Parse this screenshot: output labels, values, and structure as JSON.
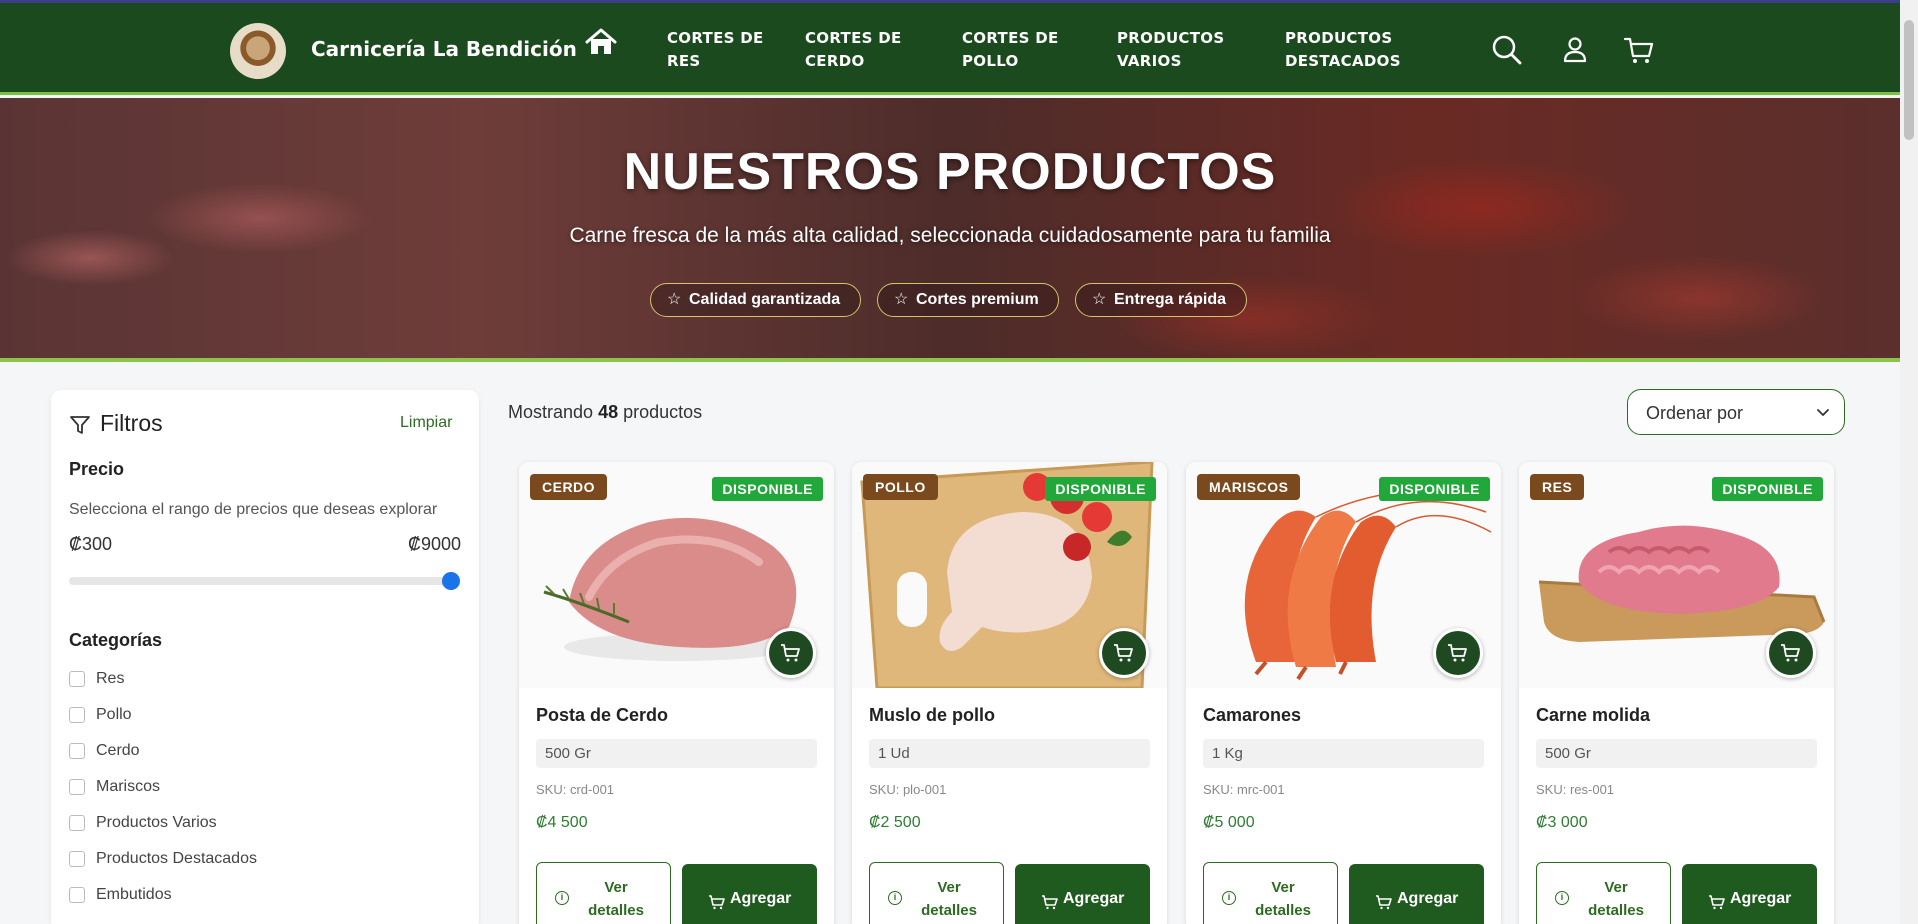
{
  "header": {
    "brand": "Carnicería La Bendición",
    "nav": [
      "CORTES DE RES",
      "CORTES DE CERDO",
      "CORTES DE POLLO",
      "PRODUCTOS VARIOS",
      "PRODUCTOS DESTACADOS"
    ],
    "icons": [
      "home-icon",
      "search-icon",
      "user-icon",
      "cart-icon"
    ],
    "colors": {
      "header_bg": "#1a4a1e",
      "accent": "#7cc242"
    }
  },
  "hero": {
    "title": "NUESTROS PRODUCTOS",
    "subtitle": "Carne fresca de la más alta calidad, seleccionada cuidadosamente para tu familia",
    "pills": [
      "Calidad garantizada",
      "Cortes premium",
      "Entrega rápida"
    ]
  },
  "sidebar": {
    "title": "Filtros",
    "clear": "Limpiar",
    "price_title": "Precio",
    "price_help": "Selecciona el rango de precios que deseas explorar",
    "price_min": "₡300",
    "price_max": "₡9000",
    "slider_value_fraction": 1.0,
    "categories_title": "Categorías",
    "categories": [
      "Res",
      "Pollo",
      "Cerdo",
      "Mariscos",
      "Productos Varios",
      "Productos Destacados",
      "Embutidos"
    ]
  },
  "results": {
    "prefix": "Mostrando",
    "count": "48",
    "suffix": "productos",
    "sort_label": "Ordenar por"
  },
  "products": [
    {
      "category": "CERDO",
      "status": "DISPONIBLE",
      "name": "Posta de Cerdo",
      "unit": "500 Gr",
      "sku": "SKU: crd-001",
      "price": "₡4 500",
      "details": "Ver detalles",
      "add": "Agregar"
    },
    {
      "category": "POLLO",
      "status": "DISPONIBLE",
      "name": "Muslo de pollo",
      "unit": "1 Ud",
      "sku": "SKU: plo-001",
      "price": "₡2 500",
      "details": "Ver detalles",
      "add": "Agregar"
    },
    {
      "category": "MARISCOS",
      "status": "DISPONIBLE",
      "name": "Camarones",
      "unit": "1 Kg",
      "sku": "SKU: mrc-001",
      "price": "₡5 000",
      "details": "Ver detalles",
      "add": "Agregar"
    },
    {
      "category": "RES",
      "status": "DISPONIBLE",
      "name": "Carne molida",
      "unit": "500 Gr",
      "sku": "SKU: res-001",
      "price": "₡3 000",
      "details": "Ver detalles",
      "add": "Agregar"
    }
  ]
}
